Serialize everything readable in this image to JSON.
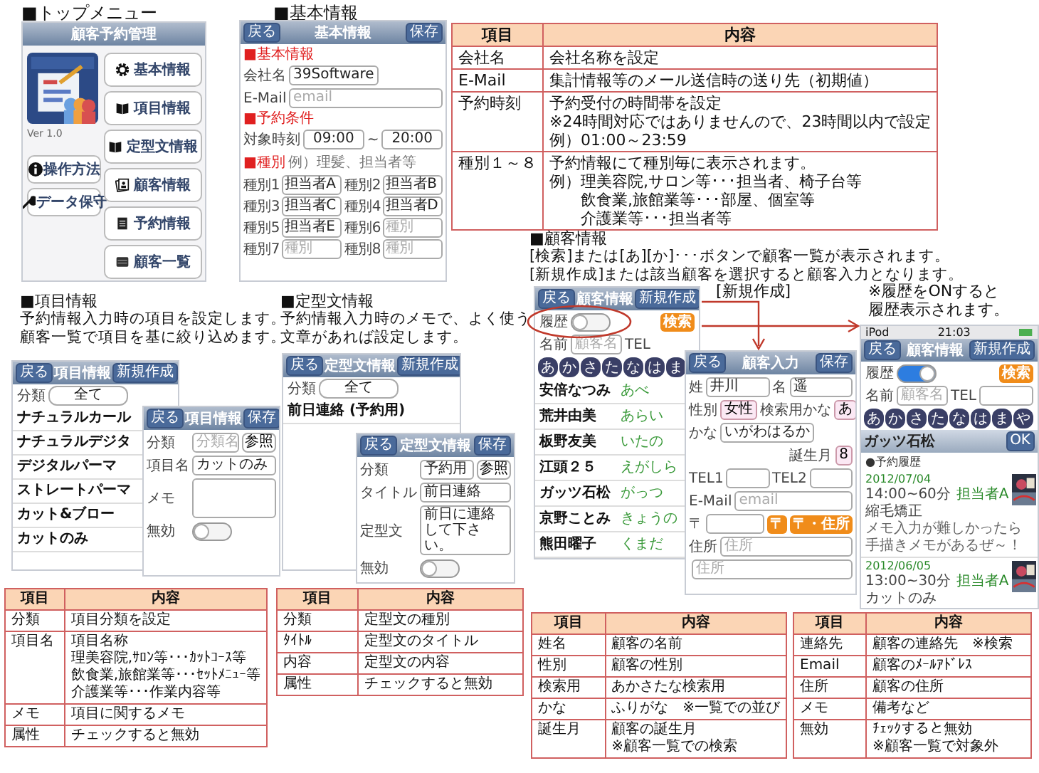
{
  "top_menu": {
    "heading": "■トップメニュー",
    "app_title": "顧客予約管理",
    "version": "Ver 1.0",
    "menu_buttons": [
      {
        "label": "基本情報",
        "kind": "gear"
      },
      {
        "label": "項目情報",
        "kind": "book"
      },
      {
        "label": "定型文情報",
        "kind": "book"
      },
      {
        "label": "顧客情報",
        "kind": "cards"
      },
      {
        "label": "予約情報",
        "kind": "doc"
      },
      {
        "label": "顧客一覧",
        "kind": "list"
      }
    ],
    "side_buttons": [
      {
        "label": "操作方法",
        "kind": "info"
      },
      {
        "label": "データ保守",
        "kind": "wrench"
      }
    ]
  },
  "basic_info": {
    "heading": "■基本情報",
    "nav": {
      "back": "戻る",
      "title": "基本情報",
      "action": "保存"
    },
    "section_company": "■基本情報",
    "company_label": "会社名",
    "company_value": "39Software",
    "email_label": "E-Mail",
    "email_placeholder": "email",
    "section_reservation": "■予約条件",
    "time_label": "対象時刻",
    "time_from": "09:00",
    "time_sep": "~",
    "time_to": "20:00",
    "section_types": "■種別",
    "types_hint": "例）理髪、担当者等",
    "types": [
      {
        "label": "種別1",
        "value": "担当者A"
      },
      {
        "label": "種別2",
        "value": "担当者B"
      },
      {
        "label": "種別3",
        "value": "担当者C"
      },
      {
        "label": "種別4",
        "value": "担当者D"
      },
      {
        "label": "種別5",
        "value": "担当者E"
      },
      {
        "label": "種別6",
        "placeholder": "種別"
      },
      {
        "label": "種別7",
        "placeholder": "種別"
      },
      {
        "label": "種別8",
        "placeholder": "種別"
      }
    ]
  },
  "basic_table": {
    "headers": [
      "項目",
      "内容"
    ],
    "rows": [
      {
        "item": "会社名",
        "lines": [
          "会社名称を設定"
        ]
      },
      {
        "item": "E-Mail",
        "lines": [
          "集計情報等のメール送信時の送り先（初期値）"
        ]
      },
      {
        "item": "予約時刻",
        "lines": [
          "予約受付の時間帯を設定",
          "※24時間対応ではありませんので、23時間以内で設定",
          "例）01:00～23:59"
        ]
      },
      {
        "item": "種別１～８",
        "lines": [
          "予約情報にて種別毎に表示されます。",
          "例）理美容院,サロン等･･･担当者、椅子台等",
          "　　飲食業,旅館業等･･･部屋、個室等",
          "　　介護業等･･･担当者等"
        ]
      }
    ]
  },
  "item_info": {
    "heading": "■項目情報",
    "description": [
      "予約情報入力時の項目を設定します。",
      "顧客一覧で項目を基に絞り込めます。"
    ],
    "list_screen": {
      "nav": {
        "back": "戻る",
        "title": "項目情報",
        "action": "新規作成"
      },
      "filter_label": "分類",
      "filter_value": "全て",
      "items": [
        "ナチュラルカール",
        "ナチュラルデジタ",
        "デジタルパーマ",
        "ストレートパーマ",
        "カット&ブロー",
        "カットのみ"
      ]
    },
    "edit_screen": {
      "nav": {
        "back": "戻る",
        "title": "項目情報",
        "action": "保存"
      },
      "category_label": "分類",
      "category_placeholder": "分類名",
      "lookup_button": "参照",
      "name_label": "項目名",
      "name_value": "カットのみ",
      "memo_label": "メモ",
      "disabled_label": "無効",
      "disabled_on": false
    }
  },
  "template_info": {
    "heading": "■定型文情報",
    "description": "予約情報入力時のメモで、よく使う文章があれば設定します。",
    "list_screen": {
      "nav": {
        "back": "戻る",
        "title": "定型文情報",
        "action": "新規作成"
      },
      "filter_label": "分類",
      "filter_value": "全て",
      "items": [
        "前日連絡 (予約用)"
      ]
    },
    "edit_screen": {
      "nav": {
        "back": "戻る",
        "title": "定型文情報",
        "action": "保存"
      },
      "category_label": "分類",
      "category_value": "予約用",
      "lookup_button": "参照",
      "title_label": "タイトル",
      "title_value": "前日連絡",
      "body_label": "定型文",
      "body_value": "前日に連絡して下さい。",
      "disabled_label": "無効",
      "disabled_on": false
    }
  },
  "customer_info": {
    "heading": "■顧客情報",
    "description": [
      "[検索]または[あ][か]･･･ボタンで顧客一覧が表示されます。",
      "[新規作成]または該当顧客を選択すると顧客入力となります。"
    ],
    "list_screen": {
      "nav": {
        "back": "戻る",
        "title": "顧客情報",
        "action": "新規作成"
      },
      "history_label": "履歴",
      "history_on": false,
      "search_button": "検索",
      "name_label": "名前",
      "name_placeholder": "顧客名",
      "tel_label": "TEL",
      "kana": [
        "あ",
        "か",
        "さ",
        "た",
        "な",
        "は",
        "ま"
      ],
      "customers": [
        {
          "name": "安倍なつみ",
          "kana": "あべ"
        },
        {
          "name": "荒井由美",
          "kana": "あらい"
        },
        {
          "name": "板野友美",
          "kana": "いたの"
        },
        {
          "name": "江頭２５",
          "kana": "えがしら"
        },
        {
          "name": "ガッツ石松",
          "kana": "がっつ"
        },
        {
          "name": "京野ことみ",
          "kana": "きょうの"
        },
        {
          "name": "熊田曜子",
          "kana": "くまだ"
        }
      ]
    },
    "new_label": "[新規作成]",
    "entry_screen": {
      "nav": {
        "back": "戻る",
        "title": "顧客入力",
        "action": "保存"
      },
      "last_label": "姓",
      "last_value": "井川",
      "first_label": "名",
      "first_value": "遥",
      "gender_label": "性別",
      "gender_value": "女性",
      "search_kana_label": "検索用かな",
      "search_kana_value": "あ",
      "kana_label": "かな",
      "kana_value": "いがわはるか",
      "birth_label": "誕生月",
      "birth_value": "8",
      "tel1_label": "TEL1",
      "tel2_label": "TEL2",
      "email_label": "E-Mail",
      "email_placeholder": "email",
      "zip_label": "〒",
      "zip_button": "〒",
      "zip_address_button": "〒・住所",
      "address_label": "住所",
      "address_placeholders": [
        "住所",
        "住所"
      ]
    },
    "history_note": [
      "※履歴をONすると",
      "履歴表示されます。"
    ],
    "history_screen": {
      "status": {
        "device": "iPod",
        "time": "21:03"
      },
      "nav": {
        "back": "戻る",
        "title": "顧客情報",
        "action": "新規作成"
      },
      "history_label": "履歴",
      "history_on": true,
      "search_button": "検索",
      "name_label": "名前",
      "name_placeholder": "顧客名",
      "tel_label": "TEL",
      "kana": [
        "あ",
        "か",
        "さ",
        "た",
        "な",
        "は",
        "ま",
        "や"
      ],
      "customer_name": "ガッツ石松",
      "ok_button": "OK",
      "history_heading": "●予約履歴",
      "entries": [
        {
          "date": "2012/07/04",
          "time": "14:00~60分",
          "staff": "担当者A",
          "menu": "縮毛矯正",
          "memo": "メモ入力が難しかったら手描きメモがあるぜ～！"
        },
        {
          "date": "2012/06/05",
          "time": "13:00~30分",
          "staff": "担当者A",
          "menu": "カットのみ"
        }
      ]
    }
  },
  "item_table": {
    "headers": [
      "項目",
      "内容"
    ],
    "rows": [
      {
        "item": "分類",
        "lines": [
          "項目分類を設定"
        ]
      },
      {
        "item": "項目名",
        "lines": [
          "項目名称",
          "理美容院,ｻﾛﾝ等･･･ｶｯﾄｺｰｽ等",
          "飲食業,旅館業等･･･ｾｯﾄﾒﾆｭｰ等",
          "介護業等･･･作業内容等"
        ]
      },
      {
        "item": "メモ",
        "lines": [
          "項目に関するメモ"
        ]
      },
      {
        "item": "属性",
        "lines": [
          "チェックすると無効"
        ]
      }
    ]
  },
  "template_table": {
    "headers": [
      "項目",
      "内容"
    ],
    "rows": [
      {
        "item": "分類",
        "lines": [
          "定型文の種別"
        ]
      },
      {
        "item": "ﾀｲﾄﾙ",
        "lines": [
          "定型文のタイトル"
        ]
      },
      {
        "item": "内容",
        "lines": [
          "定型文の内容"
        ]
      },
      {
        "item": "属性",
        "lines": [
          "チェックすると無効"
        ]
      }
    ]
  },
  "customer_table_1": {
    "headers": [
      "項目",
      "内容"
    ],
    "rows": [
      {
        "item": "姓名",
        "lines": [
          "顧客の名前"
        ]
      },
      {
        "item": "性別",
        "lines": [
          "顧客の性別"
        ]
      },
      {
        "item": "検索用",
        "lines": [
          "あかさたな検索用"
        ]
      },
      {
        "item": "かな",
        "lines": [
          "ふりがな　※一覧での並び"
        ]
      },
      {
        "item": "誕生月",
        "lines": [
          "顧客の誕生月",
          "※顧客一覧での検索"
        ]
      }
    ]
  },
  "customer_table_2": {
    "headers": [
      "項目",
      "内容"
    ],
    "rows": [
      {
        "item": "連絡先",
        "lines": [
          "顧客の連絡先　※検索"
        ]
      },
      {
        "item": "Email",
        "lines": [
          "顧客のﾒｰﾙｱﾄﾞﾚｽ"
        ]
      },
      {
        "item": "住所",
        "lines": [
          "顧客の住所"
        ]
      },
      {
        "item": "メモ",
        "lines": [
          "備考など"
        ]
      },
      {
        "item": "無効",
        "lines": [
          "ﾁｪｯｸすると無効",
          "※顧客一覧で対象外"
        ]
      }
    ]
  }
}
